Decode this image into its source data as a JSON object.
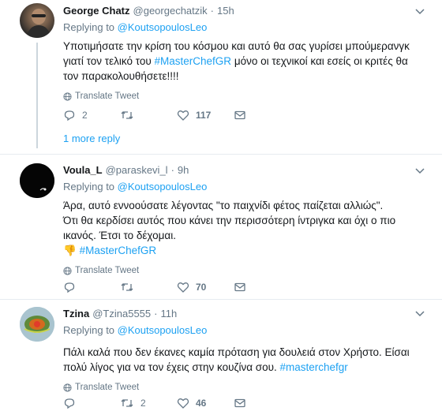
{
  "tweets": [
    {
      "name": "George Chatz",
      "handle": "@georgechatzik",
      "time": "15h",
      "replying_prefix": "Replying to ",
      "replying_to": "@KoutsopoulosLeo",
      "text_before": "Υποτιμήσατε την κρίση του κόσμου και αυτό θα σας γυρίσει μπούμερανγκ γιατί τον τελικό του ",
      "hashtag": "#MasterChefGR",
      "text_after": " μόνο οι τεχνικοί και εσείς οι κριτές θα τον παρακολουθήσετε!!!!",
      "translate": "Translate Tweet",
      "reply_count": "2",
      "retweet_count": "",
      "like_count": "117",
      "more": "1 more reply"
    },
    {
      "name": "Voula_L",
      "handle": "@paraskevi_l",
      "time": "9h",
      "replying_prefix": "Replying to ",
      "replying_to": "@KoutsopoulosLeo",
      "line1": "Άρα, αυτό εννοούσατε λέγοντας  \"το παιχνίδι φέτος παίζεται αλλιώς\".",
      "line2": "Ότι θα κερδίσει αυτός που κάνει την περισσότερη ίντριγκα και όχι ο πιο ικανός. Έτσι το δέχομαι.",
      "emoji": "👎",
      "hashtag": "#MasterChefGR",
      "translate": "Translate Tweet",
      "reply_count": "",
      "retweet_count": "",
      "like_count": "70"
    },
    {
      "name": "Tzina",
      "handle": "@Tzina5555",
      "time": "11h",
      "replying_prefix": "Replying to ",
      "replying_to": "@KoutsopoulosLeo",
      "text_before": "Πάλι καλά που δεν έκανες καμία πρόταση για δουλειά στον Χρήστο. Είσαι πολύ λίγος για να τον έχεις στην κουζίνα σου. ",
      "hashtag": "#masterchefgr",
      "translate": "Translate Tweet",
      "reply_count": "",
      "retweet_count": "2",
      "like_count": "46"
    }
  ],
  "separator": "·",
  "colors": {
    "accent": "#1da1f2",
    "muted": "#657786",
    "text": "#14171a"
  }
}
